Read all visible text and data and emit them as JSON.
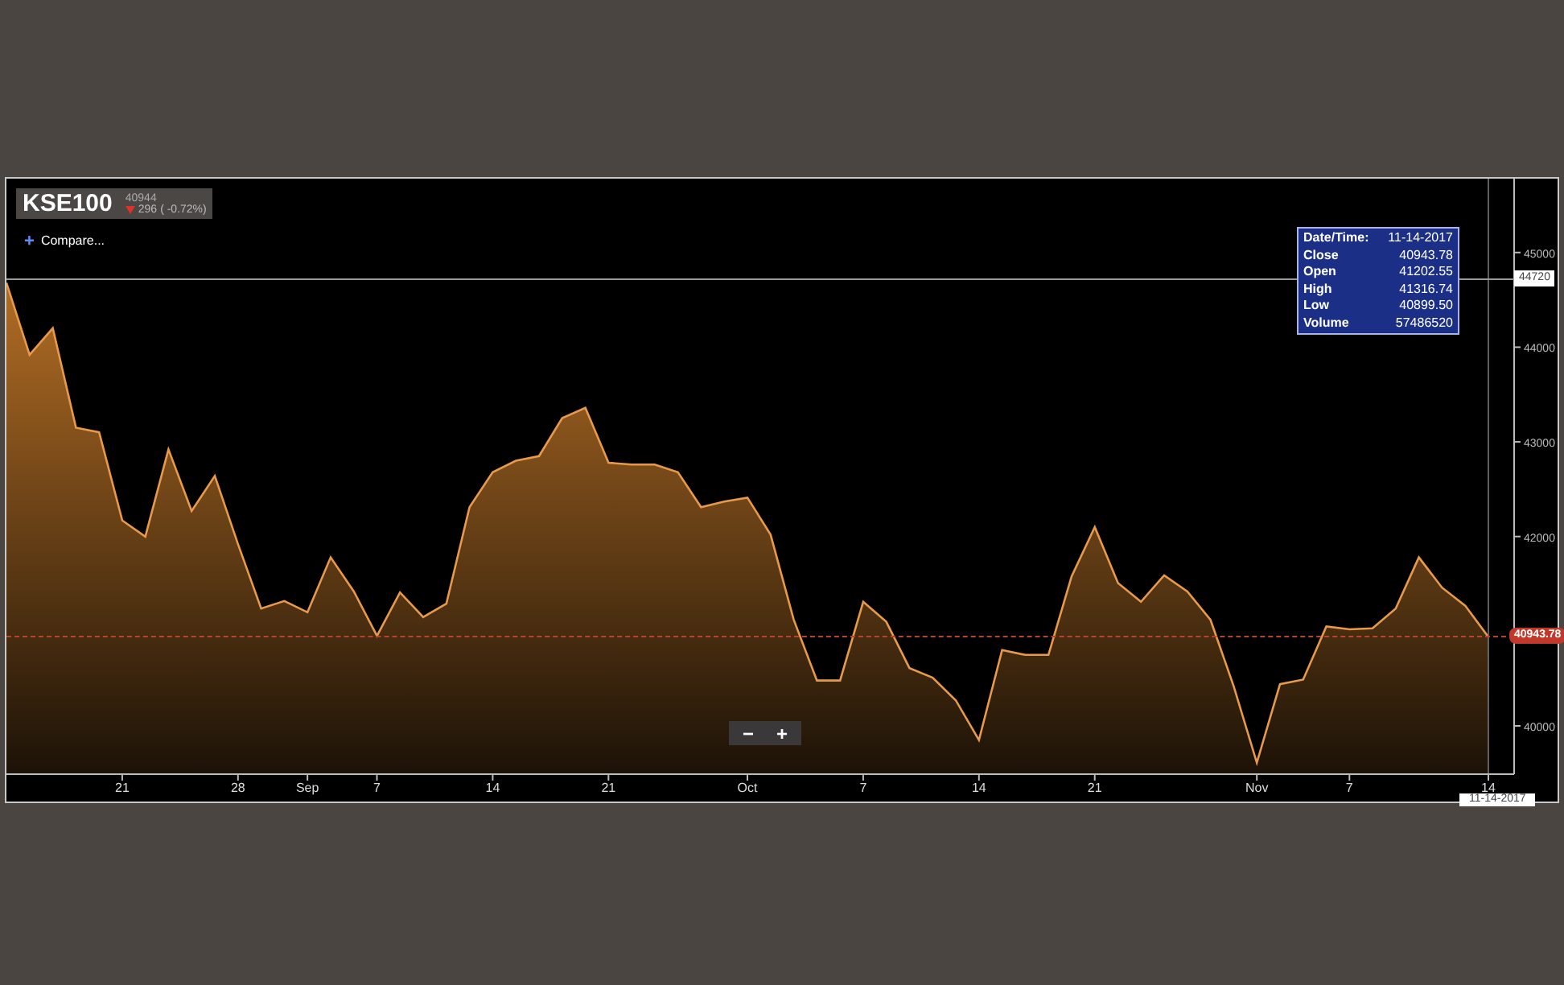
{
  "legend": {
    "symbol": "KSE100",
    "last": "40944",
    "falling": true,
    "change": "296",
    "percent": "( -0.72%)"
  },
  "compare": {
    "icon": "+",
    "label": "Compare..."
  },
  "tooltip": {
    "rows": [
      {
        "label": "Date/Time:",
        "value": "11-14-2017"
      },
      {
        "label": "Close",
        "value": "40943.78"
      },
      {
        "label": "Open",
        "value": "41202.55"
      },
      {
        "label": "High",
        "value": "41316.74"
      },
      {
        "label": "Low",
        "value": "40899.50"
      },
      {
        "label": "Volume",
        "value": "57486520"
      }
    ]
  },
  "crosshair": {
    "date_label": "11-14-2017"
  },
  "price_markers": [
    {
      "kind": "crosshair",
      "label": "44720"
    },
    {
      "kind": "last_price",
      "label": "40943.78"
    }
  ],
  "zoom_buttons": [
    {
      "label": "−"
    },
    {
      "label": "+"
    }
  ],
  "chart_data": {
    "type": "area",
    "ylim": [
      39490,
      45780
    ],
    "categories": [
      null,
      null,
      null,
      null,
      null,
      "21",
      null,
      null,
      null,
      null,
      "28",
      null,
      null,
      "Sep",
      null,
      null,
      "7",
      null,
      null,
      null,
      null,
      "14",
      null,
      null,
      null,
      null,
      "21",
      null,
      null,
      null,
      null,
      null,
      "Oct",
      null,
      null,
      null,
      null,
      "7",
      null,
      null,
      null,
      null,
      "14",
      null,
      null,
      null,
      null,
      "21",
      null,
      null,
      null,
      null,
      null,
      null,
      "Nov",
      null,
      null,
      null,
      "7",
      null,
      null,
      null,
      null,
      null,
      "14"
    ],
    "series": [
      {
        "color": "#e89a4c",
        "values": [
          44680,
          43920,
          44200,
          43150,
          43100,
          42170,
          42000,
          42920,
          42270,
          42640,
          41920,
          41240,
          41320,
          41200,
          41780,
          41420,
          40950,
          41410,
          41150,
          41290,
          42310,
          42680,
          42800,
          42850,
          43250,
          43360,
          42780,
          42760,
          42760,
          42680,
          42310,
          42370,
          42410,
          42020,
          41120,
          40480,
          40480,
          41310,
          41100,
          40610,
          40510,
          40270,
          39850,
          40800,
          40750,
          40750,
          41580,
          42100,
          41510,
          41310,
          41590,
          41420,
          41120,
          40420,
          39610,
          40440,
          40490,
          41050,
          41020,
          41030,
          41240,
          41780,
          41460,
          41270,
          40940
        ]
      }
    ],
    "yticks": [
      40000,
      42000,
      43000,
      44000,
      45000
    ]
  }
}
